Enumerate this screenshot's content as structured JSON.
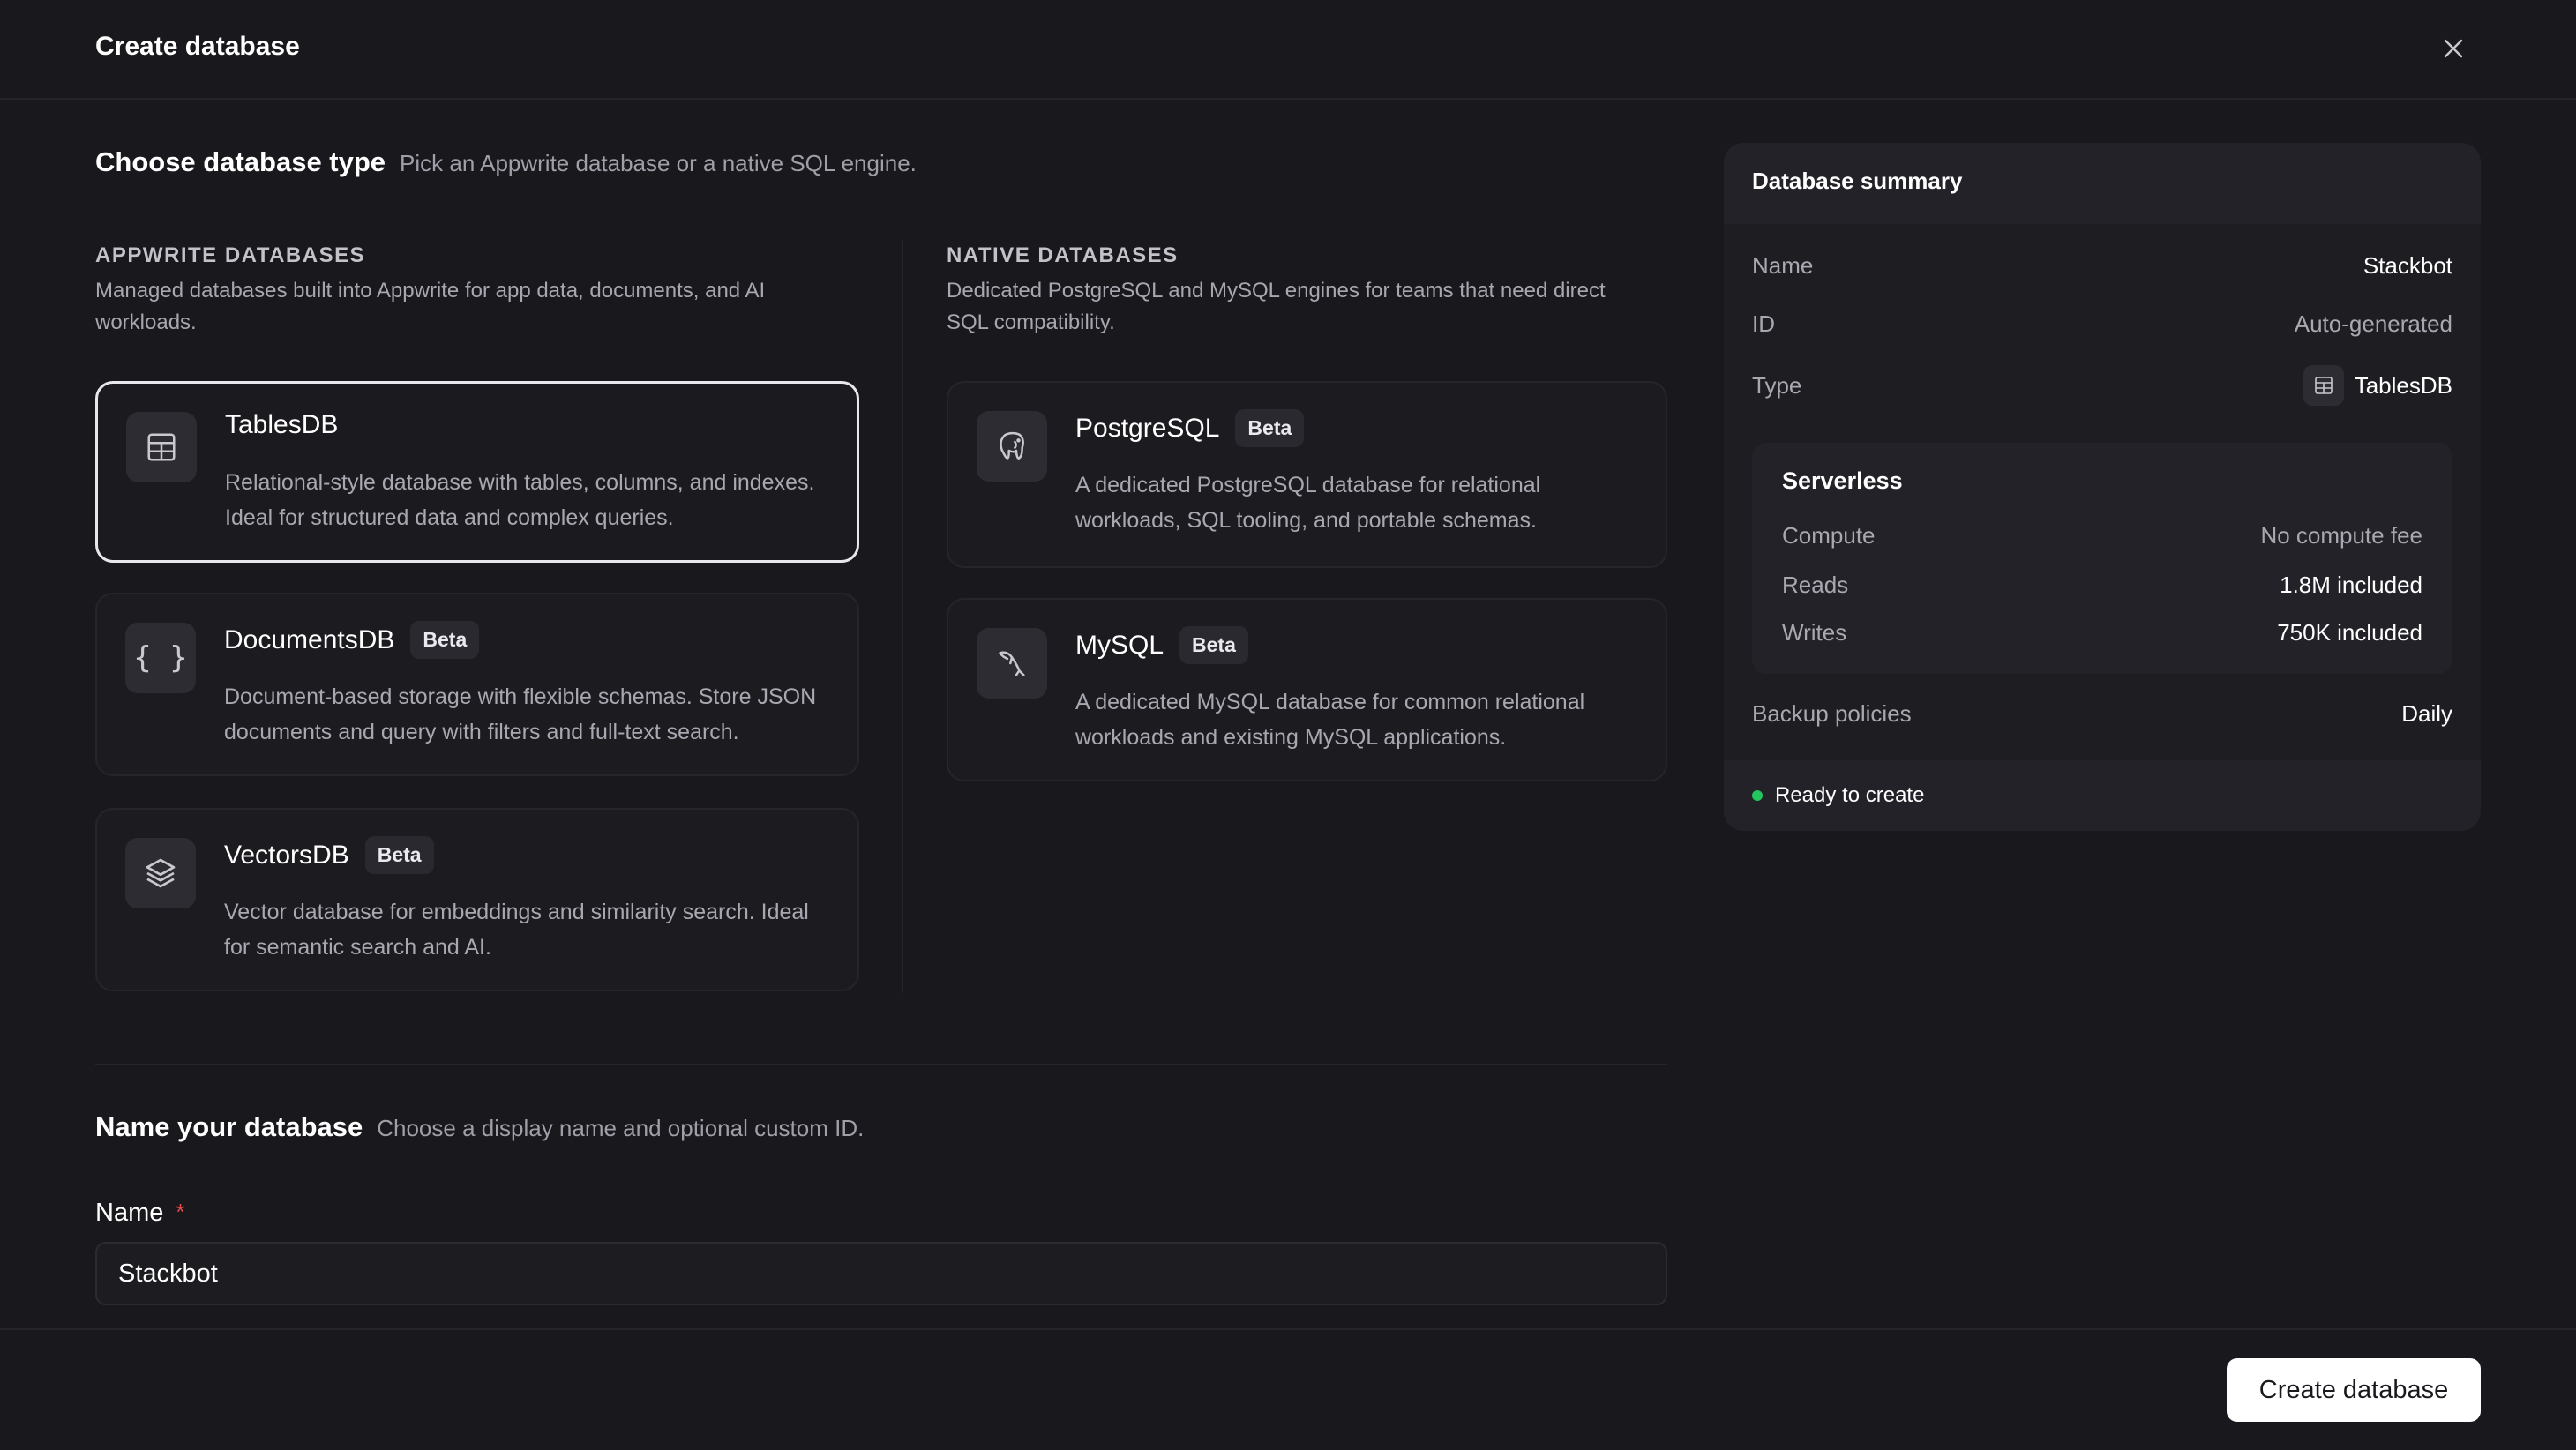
{
  "dialog": {
    "title": "Create database",
    "close_icon": "close-icon"
  },
  "choose": {
    "heading": "Choose database type",
    "subheading": "Pick an Appwrite database or a native SQL engine."
  },
  "appwrite": {
    "title": "APPWRITE DATABASES",
    "desc_line1": "Managed databases built into Appwrite for app data, documents, and AI",
    "desc_line2": "workloads.",
    "cards": [
      {
        "title": "TablesDB",
        "badge": "",
        "icon": "table-icon",
        "desc1": "Relational-style database with tables, columns, and indexes.",
        "desc2": "Ideal for structured data and complex queries.",
        "selected": true
      },
      {
        "title": "DocumentsDB",
        "badge": "Beta",
        "icon": "braces-icon",
        "desc1": "Document-based storage with flexible schemas. Store JSON",
        "desc2": "documents and query with filters and full-text search.",
        "selected": false
      },
      {
        "title": "VectorsDB",
        "badge": "Beta",
        "icon": "layers-icon",
        "desc1": "Vector database for embeddings and similarity search. Ideal",
        "desc2": "for semantic search and AI.",
        "selected": false
      }
    ]
  },
  "native": {
    "title": "NATIVE DATABASES",
    "desc_line1": "Dedicated PostgreSQL and MySQL engines for teams that need direct",
    "desc_line2": "SQL compatibility.",
    "cards": [
      {
        "title": "PostgreSQL",
        "badge": "Beta",
        "icon": "elephant-icon",
        "desc1": "A dedicated PostgreSQL database for relational",
        "desc2": "workloads, SQL tooling, and portable schemas."
      },
      {
        "title": "MySQL",
        "badge": "Beta",
        "icon": "dolphin-icon",
        "desc1": "A dedicated MySQL database for common relational",
        "desc2": "workloads and existing MySQL applications."
      }
    ]
  },
  "naming": {
    "heading": "Name your database",
    "subheading": "Choose a display name and optional custom ID.",
    "name_label": "Name",
    "required_mark": "*",
    "name_value": "Stackbot"
  },
  "summary": {
    "title": "Database summary",
    "name_key": "Name",
    "name_val": "Stackbot",
    "id_key": "ID",
    "id_val": "Auto-generated",
    "type_key": "Type",
    "type_val": "TablesDB",
    "serverless": {
      "title": "Serverless",
      "compute_key": "Compute",
      "compute_val": "No compute fee",
      "reads_key": "Reads",
      "reads_val": "1.8M included",
      "writes_key": "Writes",
      "writes_val": "750K included"
    },
    "backup_key": "Backup policies",
    "backup_val": "Daily",
    "status": "Ready to create",
    "status_color": "#22c55e"
  },
  "footer": {
    "create_label": "Create database"
  },
  "colors": {
    "background": "#19181d",
    "card": "#1c1b20",
    "accent_button": "#ffffff",
    "required": "#e5484d"
  }
}
